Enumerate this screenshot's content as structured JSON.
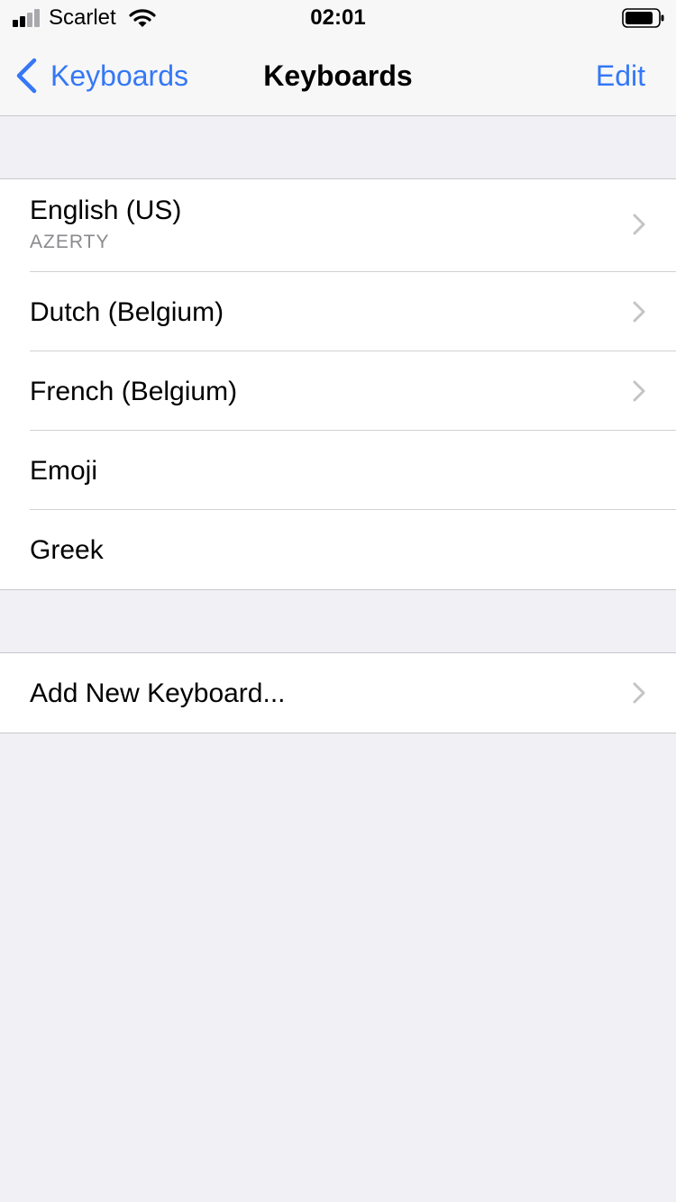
{
  "status_bar": {
    "carrier": "Scarlet",
    "time": "02:01",
    "icons": [
      "signal-icon",
      "wifi-icon",
      "battery-icon"
    ]
  },
  "nav": {
    "back_label": "Keyboards",
    "title": "Keyboards",
    "edit_label": "Edit"
  },
  "keyboards": [
    {
      "title": "English (US)",
      "subtitle": "AZERTY",
      "chevron": true
    },
    {
      "title": "Dutch (Belgium)",
      "chevron": true
    },
    {
      "title": "French (Belgium)",
      "chevron": true
    },
    {
      "title": "Emoji",
      "chevron": false
    },
    {
      "title": "Greek",
      "chevron": false
    }
  ],
  "add_keyboard": {
    "title": "Add New Keyboard...",
    "chevron": true
  },
  "colors": {
    "accent": "#3478f6",
    "background": "#f0f0f5",
    "secondary_text": "#8a8a8e",
    "separator": "#c8c7cc"
  }
}
